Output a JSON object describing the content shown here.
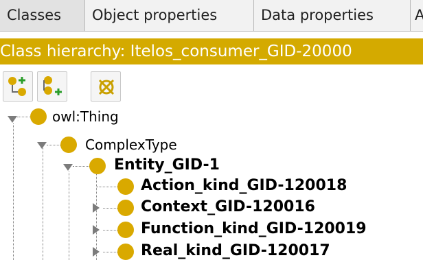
{
  "tabs": [
    {
      "label": "Classes",
      "active": true
    },
    {
      "label": "Object properties",
      "active": false
    },
    {
      "label": "Data properties",
      "active": false
    },
    {
      "label": "A",
      "active": false
    }
  ],
  "hierarchy_header": "Class hierarchy: Itelos_consumer_GID-20000",
  "toolbar": {
    "buttons": [
      {
        "name": "add-subclass",
        "icon": "add-subclass-icon"
      },
      {
        "name": "add-sibling-class",
        "icon": "add-sibling-class-icon"
      },
      {
        "name": "delete-class",
        "icon": "delete-class-icon"
      }
    ]
  },
  "colors": {
    "header_bg": "#d4aa00",
    "class_icon": "#d9a900"
  },
  "tree": [
    {
      "label": "owl:Thing",
      "level": 0,
      "expanded": true
    },
    {
      "label": "ComplexType",
      "level": 1,
      "expanded": true
    },
    {
      "label": "Entity_GID-1",
      "level": 2,
      "expanded": true
    },
    {
      "label": "Action_kind_GID-120018",
      "level": 3,
      "expanded": null
    },
    {
      "label": "Context_GID-120016",
      "level": 3,
      "expanded": false
    },
    {
      "label": "Function_kind_GID-120019",
      "level": 3,
      "expanded": false
    },
    {
      "label": "Real_kind_GID-120017",
      "level": 3,
      "expanded": false
    }
  ]
}
